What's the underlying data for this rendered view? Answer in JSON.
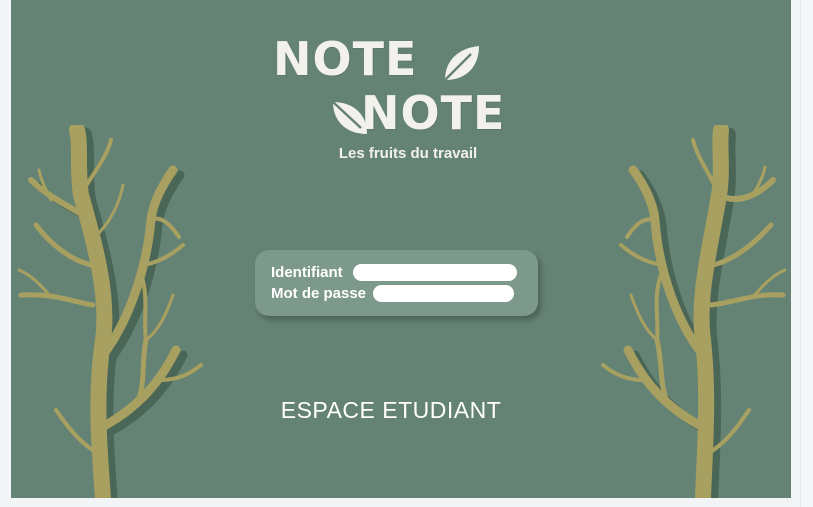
{
  "app": {
    "logo": {
      "word_1": "NOTE",
      "word_2": "NOTE"
    },
    "tagline": "Les fruits du travail"
  },
  "login": {
    "identifiant_label": "Identifiant",
    "identifiant_value": "",
    "password_label": "Mot de passe",
    "password_value": ""
  },
  "espace_label": "ESPACE ETUDIANT",
  "icons": {
    "logo_leaf": "leaf-icon",
    "tree_left": "bare-tree",
    "tree_right": "bare-tree"
  },
  "colors": {
    "background": "#658374",
    "card": "#7d998b",
    "tree": "#a8a060",
    "text": "#f2f1ec"
  }
}
